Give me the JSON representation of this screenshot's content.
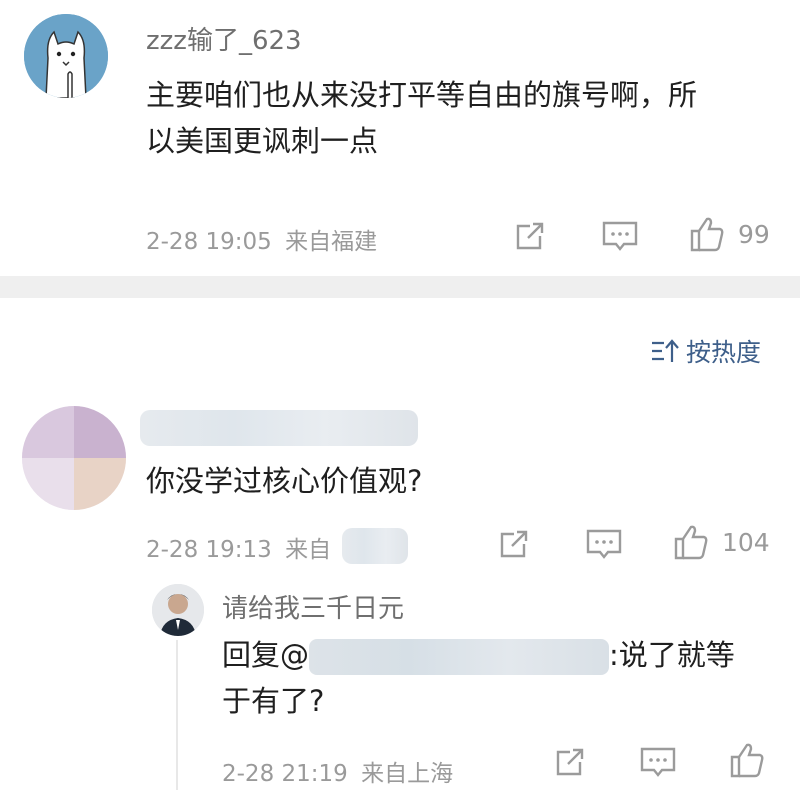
{
  "comments": [
    {
      "username": "zzz输了_623",
      "content_line1": "主要咱们也从来没打平等自由的旗号啊，所",
      "content_line2": "以美国更讽刺一点",
      "time": "2-28 19:05",
      "location": "来自福建",
      "likes": "99"
    },
    {
      "username": "",
      "content": "你没学过核心价值观?",
      "time": "2-28 19:13",
      "location": "来自",
      "likes": "104",
      "reply": {
        "username": "请给我三千日元",
        "prefix": "回复@",
        "content_tail": ":说了就等",
        "content_line2": "于有了?",
        "time": "2-28 21:19",
        "location": "来自上海"
      }
    }
  ],
  "sort_label": "按热度",
  "icons": {
    "share": "share-icon",
    "comment": "comment-icon",
    "like": "thumbs-up-icon",
    "sort": "sort-icon"
  },
  "colors": {
    "link_blue": "#3e5f8a",
    "meta_gray": "#9a9a9a",
    "divider": "#efefef"
  }
}
